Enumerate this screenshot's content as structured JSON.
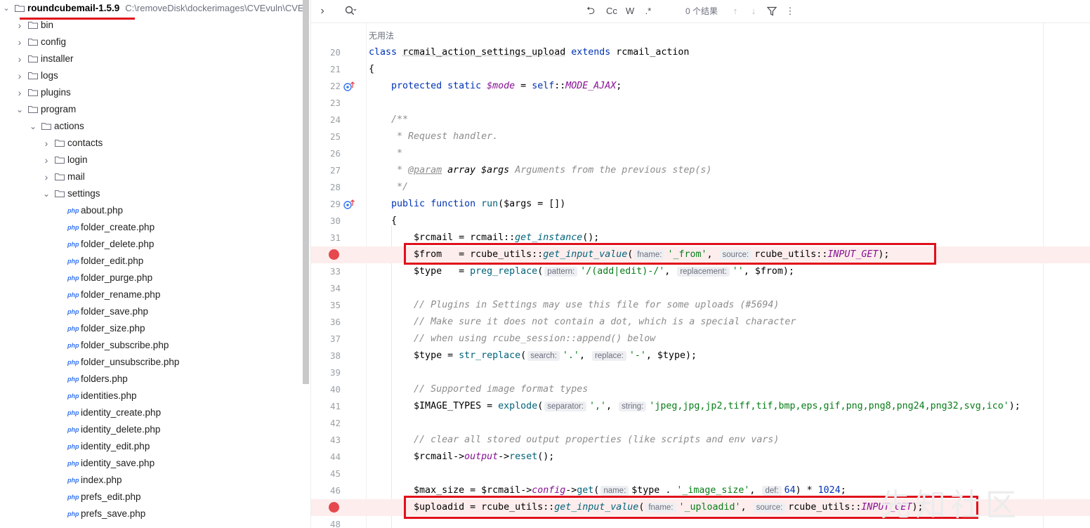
{
  "tree": {
    "root": {
      "label": "roundcubemail-1.5.9",
      "path": "C:\\removeDisk\\dockerimages\\CVEvuln\\CVE"
    },
    "items": [
      {
        "label": "bin",
        "type": "folder",
        "depth": 1,
        "state": "collapsed"
      },
      {
        "label": "config",
        "type": "folder",
        "depth": 1,
        "state": "collapsed"
      },
      {
        "label": "installer",
        "type": "folder",
        "depth": 1,
        "state": "collapsed"
      },
      {
        "label": "logs",
        "type": "folder",
        "depth": 1,
        "state": "collapsed"
      },
      {
        "label": "plugins",
        "type": "folder",
        "depth": 1,
        "state": "collapsed"
      },
      {
        "label": "program",
        "type": "folder",
        "depth": 1,
        "state": "expanded"
      },
      {
        "label": "actions",
        "type": "folder",
        "depth": 2,
        "state": "expanded"
      },
      {
        "label": "contacts",
        "type": "folder",
        "depth": 3,
        "state": "collapsed"
      },
      {
        "label": "login",
        "type": "folder",
        "depth": 3,
        "state": "collapsed"
      },
      {
        "label": "mail",
        "type": "folder",
        "depth": 3,
        "state": "collapsed"
      },
      {
        "label": "settings",
        "type": "folder",
        "depth": 3,
        "state": "expanded"
      },
      {
        "label": "about.php",
        "type": "php",
        "depth": 4
      },
      {
        "label": "folder_create.php",
        "type": "php",
        "depth": 4
      },
      {
        "label": "folder_delete.php",
        "type": "php",
        "depth": 4
      },
      {
        "label": "folder_edit.php",
        "type": "php",
        "depth": 4
      },
      {
        "label": "folder_purge.php",
        "type": "php",
        "depth": 4
      },
      {
        "label": "folder_rename.php",
        "type": "php",
        "depth": 4
      },
      {
        "label": "folder_save.php",
        "type": "php",
        "depth": 4
      },
      {
        "label": "folder_size.php",
        "type": "php",
        "depth": 4
      },
      {
        "label": "folder_subscribe.php",
        "type": "php",
        "depth": 4
      },
      {
        "label": "folder_unsubscribe.php",
        "type": "php",
        "depth": 4
      },
      {
        "label": "folders.php",
        "type": "php",
        "depth": 4
      },
      {
        "label": "identities.php",
        "type": "php",
        "depth": 4
      },
      {
        "label": "identity_create.php",
        "type": "php",
        "depth": 4
      },
      {
        "label": "identity_delete.php",
        "type": "php",
        "depth": 4
      },
      {
        "label": "identity_edit.php",
        "type": "php",
        "depth": 4
      },
      {
        "label": "identity_save.php",
        "type": "php",
        "depth": 4
      },
      {
        "label": "index.php",
        "type": "php",
        "depth": 4
      },
      {
        "label": "prefs_edit.php",
        "type": "php",
        "depth": 4
      },
      {
        "label": "prefs_save.php",
        "type": "php",
        "depth": 4
      }
    ],
    "php_icon_text": "php"
  },
  "toolbar": {
    "expand_icon": "›",
    "search_icon": "search-options-icon",
    "replace_label": "⮌",
    "match_case": "Cc",
    "words": "W",
    "regex": ".*",
    "results": "0 个结果",
    "up": "↑",
    "down": "↓",
    "filter": "⏷",
    "more": "⋮"
  },
  "editor": {
    "usage_hint": "无用法",
    "lines": [
      {
        "n": "20",
        "tokens": [
          [
            "kw",
            "class "
          ],
          [
            "ucls",
            "rcmail_action_settings_upload"
          ],
          [
            "kw",
            " extends "
          ],
          [
            "cls",
            "rcmail_action"
          ]
        ]
      },
      {
        "n": "21",
        "tokens": [
          [
            "cls",
            "{"
          ]
        ]
      },
      {
        "n": "22",
        "override": true,
        "tokens": [
          [
            "cls",
            "    "
          ],
          [
            "kw",
            "protected static "
          ],
          [
            "ivar",
            "$mode"
          ],
          [
            "cls",
            " = "
          ],
          [
            "kw",
            "self"
          ],
          [
            "cls",
            "::"
          ],
          [
            "const",
            "MODE_AJAX"
          ],
          [
            "cls",
            ";"
          ]
        ]
      },
      {
        "n": "23",
        "tokens": []
      },
      {
        "n": "24",
        "tokens": [
          [
            "cls",
            "    "
          ],
          [
            "cmt",
            "/**"
          ]
        ]
      },
      {
        "n": "25",
        "tokens": [
          [
            "cls",
            "    "
          ],
          [
            "cmt",
            " * Request handler."
          ]
        ]
      },
      {
        "n": "26",
        "tokens": [
          [
            "cls",
            "    "
          ],
          [
            "cmt",
            " *"
          ]
        ]
      },
      {
        "n": "27",
        "tokens": [
          [
            "cls",
            "    "
          ],
          [
            "cmt",
            " * "
          ],
          [
            "tag",
            "@param"
          ],
          [
            "cmt",
            " "
          ],
          [
            "docvar",
            "array $args"
          ],
          [
            "cmt",
            " Arguments from the previous step(s)"
          ]
        ]
      },
      {
        "n": "28",
        "tokens": [
          [
            "cls",
            "    "
          ],
          [
            "cmt",
            " */"
          ]
        ]
      },
      {
        "n": "29",
        "override": true,
        "tokens": [
          [
            "cls",
            "    "
          ],
          [
            "kw",
            "public function "
          ],
          [
            "fn",
            "run"
          ],
          [
            "cls",
            "("
          ],
          [
            "var",
            "$args"
          ],
          [
            "cls",
            " = [])"
          ]
        ]
      },
      {
        "n": "30",
        "tokens": [
          [
            "cls",
            "    {"
          ]
        ]
      },
      {
        "n": "31",
        "tokens": [
          [
            "cls",
            "        "
          ],
          [
            "var",
            "$rcmail"
          ],
          [
            "cls",
            " = "
          ],
          [
            "cls",
            "rcmail::"
          ],
          [
            "ifn",
            "get_instance"
          ],
          [
            "cls",
            "();"
          ]
        ]
      },
      {
        "n": "",
        "breakpoint": true,
        "tokens": [
          [
            "cls",
            "        "
          ],
          [
            "var",
            "$from"
          ],
          [
            "cls",
            "   = "
          ],
          [
            "cls",
            "rcube_utils::"
          ],
          [
            "ifn",
            "get_input_value"
          ],
          [
            "cls",
            "("
          ],
          [
            "hint",
            "fname:"
          ],
          [
            "str",
            "'_from'"
          ],
          [
            "cls",
            ", "
          ],
          [
            "hint",
            "source:"
          ],
          [
            "cls",
            "rcube_utils::"
          ],
          [
            "const",
            "INPUT_GET"
          ],
          [
            "cls",
            ");"
          ]
        ]
      },
      {
        "n": "33",
        "tokens": [
          [
            "cls",
            "        "
          ],
          [
            "var",
            "$type"
          ],
          [
            "cls",
            "   = "
          ],
          [
            "fn",
            "preg_replace"
          ],
          [
            "cls",
            "("
          ],
          [
            "hint",
            "pattern:"
          ],
          [
            "str",
            "'/(add|edit)-/'"
          ],
          [
            "cls",
            ", "
          ],
          [
            "hint",
            "replacement:"
          ],
          [
            "str",
            "''"
          ],
          [
            "cls",
            ", "
          ],
          [
            "var",
            "$from"
          ],
          [
            "cls",
            ");"
          ]
        ]
      },
      {
        "n": "34",
        "tokens": []
      },
      {
        "n": "35",
        "tokens": [
          [
            "cls",
            "        "
          ],
          [
            "cmt",
            "// Plugins in Settings may use this file for some uploads (#5694)"
          ]
        ]
      },
      {
        "n": "36",
        "tokens": [
          [
            "cls",
            "        "
          ],
          [
            "cmt",
            "// Make sure it does not contain a dot, which is a special character"
          ]
        ]
      },
      {
        "n": "37",
        "tokens": [
          [
            "cls",
            "        "
          ],
          [
            "cmt",
            "// when using rcube_session::append() below"
          ]
        ]
      },
      {
        "n": "38",
        "tokens": [
          [
            "cls",
            "        "
          ],
          [
            "var",
            "$type"
          ],
          [
            "cls",
            " = "
          ],
          [
            "fn",
            "str_replace"
          ],
          [
            "cls",
            "("
          ],
          [
            "hint",
            "search:"
          ],
          [
            "str",
            "'.'"
          ],
          [
            "cls",
            ", "
          ],
          [
            "hint",
            "replace:"
          ],
          [
            "str",
            "'-'"
          ],
          [
            "cls",
            ", "
          ],
          [
            "var",
            "$type"
          ],
          [
            "cls",
            ");"
          ]
        ]
      },
      {
        "n": "39",
        "tokens": []
      },
      {
        "n": "40",
        "tokens": [
          [
            "cls",
            "        "
          ],
          [
            "cmt",
            "// Supported image format types"
          ]
        ]
      },
      {
        "n": "41",
        "tokens": [
          [
            "cls",
            "        "
          ],
          [
            "var",
            "$IMAGE_TYPES"
          ],
          [
            "cls",
            " = "
          ],
          [
            "fn",
            "explode"
          ],
          [
            "cls",
            "("
          ],
          [
            "hint",
            "separator:"
          ],
          [
            "str",
            "','"
          ],
          [
            "cls",
            ", "
          ],
          [
            "hint",
            "string:"
          ],
          [
            "str",
            "'jpeg,jpg,jp2,tiff,tif,bmp,eps,gif,png,png8,png24,png32,svg,ico'"
          ],
          [
            "cls",
            ");"
          ]
        ]
      },
      {
        "n": "42",
        "tokens": []
      },
      {
        "n": "43",
        "tokens": [
          [
            "cls",
            "        "
          ],
          [
            "cmt",
            "// clear all stored output properties (like scripts and env vars)"
          ]
        ]
      },
      {
        "n": "44",
        "tokens": [
          [
            "cls",
            "        "
          ],
          [
            "var",
            "$rcmail"
          ],
          [
            "cls",
            "->"
          ],
          [
            "const",
            "output"
          ],
          [
            "cls",
            "->"
          ],
          [
            "fn",
            "reset"
          ],
          [
            "cls",
            "();"
          ]
        ]
      },
      {
        "n": "45",
        "tokens": []
      },
      {
        "n": "46",
        "tokens": [
          [
            "cls",
            "        "
          ],
          [
            "var",
            "$max_size"
          ],
          [
            "cls",
            " = "
          ],
          [
            "var",
            "$rcmail"
          ],
          [
            "cls",
            "->"
          ],
          [
            "const",
            "config"
          ],
          [
            "cls",
            "->"
          ],
          [
            "fn",
            "get"
          ],
          [
            "cls",
            "("
          ],
          [
            "hint",
            "name:"
          ],
          [
            "var",
            "$type"
          ],
          [
            "cls",
            " . "
          ],
          [
            "str",
            "'_image_size'"
          ],
          [
            "cls",
            ", "
          ],
          [
            "hint",
            "def:"
          ],
          [
            "kw",
            "64"
          ],
          [
            "cls",
            ") * "
          ],
          [
            "kw",
            "1024"
          ],
          [
            "cls",
            ";"
          ]
        ]
      },
      {
        "n": "",
        "breakpoint": true,
        "tokens": [
          [
            "cls",
            "        "
          ],
          [
            "var",
            "$uploadid"
          ],
          [
            "cls",
            " = "
          ],
          [
            "cls",
            "rcube_utils::"
          ],
          [
            "ifn",
            "get_input_value"
          ],
          [
            "cls",
            "("
          ],
          [
            "hint",
            "fname:"
          ],
          [
            "str",
            "'_uploadid'"
          ],
          [
            "cls",
            ", "
          ],
          [
            "hint",
            "source:"
          ],
          [
            "cls",
            "rcube_utils::"
          ],
          [
            "const",
            "INPUT_GET"
          ],
          [
            "cls",
            ");"
          ]
        ]
      },
      {
        "n": "48",
        "tokens": []
      }
    ]
  },
  "colors": {
    "highlight_box": "#e0101a",
    "breakpoint": "#e5484d",
    "keyword": "#0033b3",
    "string": "#067d17"
  },
  "watermark": "先知社区"
}
